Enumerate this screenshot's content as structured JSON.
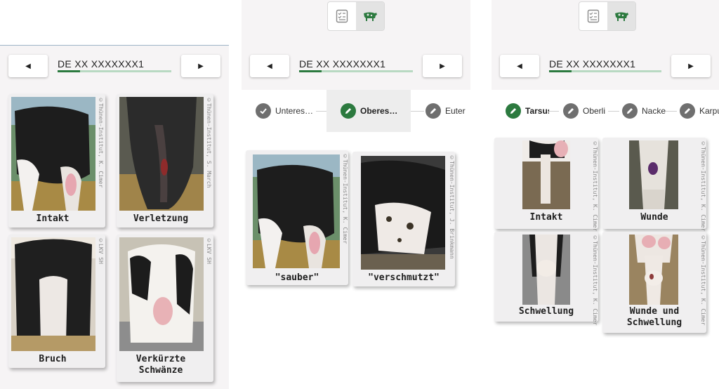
{
  "colors": {
    "accent": "#2c7a3f",
    "accent_light": "#b8d9c2",
    "icon_gray": "#6f6f6f"
  },
  "panel1": {
    "id_text": "DE XX XXXXXXX1",
    "progress": 0.2,
    "cards": [
      {
        "caption": "Intakt",
        "credit": "©Thünen-Institut, K. Cimer"
      },
      {
        "caption": "Verletzung",
        "credit": "©Thünen-Institut, S. March"
      },
      {
        "caption": "Bruch",
        "credit": "©LKV SH"
      },
      {
        "caption": "Verkürzte\nSchwänze",
        "credit": "©LKV SH"
      }
    ]
  },
  "panel2": {
    "toggle_icons": [
      "checklist-icon",
      "cow-icon"
    ],
    "id_text": "DE XX XXXXXXX1",
    "progress": 0.2,
    "steps": [
      {
        "label": "Unteres…",
        "state": "done",
        "icon": "check-icon"
      },
      {
        "label": "Oberes…",
        "state": "active",
        "icon": "pencil-icon"
      },
      {
        "label": "Euter",
        "state": "todo",
        "icon": "pencil-icon"
      }
    ],
    "cards": [
      {
        "caption": "\"sauber\"",
        "credit": "©Thünen-Institut, K. Cimer"
      },
      {
        "caption": "\"verschmutzt\"",
        "credit": "©Thünen-Institut, J. Brinkmann"
      }
    ]
  },
  "panel3": {
    "toggle_icons": [
      "checklist-icon",
      "cow-icon"
    ],
    "id_text": "DE XX XXXXXXX1",
    "progress": 0.2,
    "steps": [
      {
        "label": "Tarsus",
        "state": "active",
        "icon": "pencil-icon"
      },
      {
        "label": "Oberli",
        "state": "todo",
        "icon": "pencil-icon"
      },
      {
        "label": "Nacke",
        "state": "todo",
        "icon": "pencil-icon"
      },
      {
        "label": "Karpu",
        "state": "todo",
        "icon": "pencil-icon"
      }
    ],
    "cards": [
      {
        "caption": "Intakt",
        "credit": "©Thünen-Institut, K. Cimer"
      },
      {
        "caption": "Wunde",
        "credit": "©Thünen-Institut, K. Cimer"
      },
      {
        "caption": "Schwellung",
        "credit": "©Thünen-Institut, K. Cimer"
      },
      {
        "caption": "Wunde und\nSchwellung",
        "credit": "©Thünen-Institut, K. Cimer"
      }
    ]
  }
}
